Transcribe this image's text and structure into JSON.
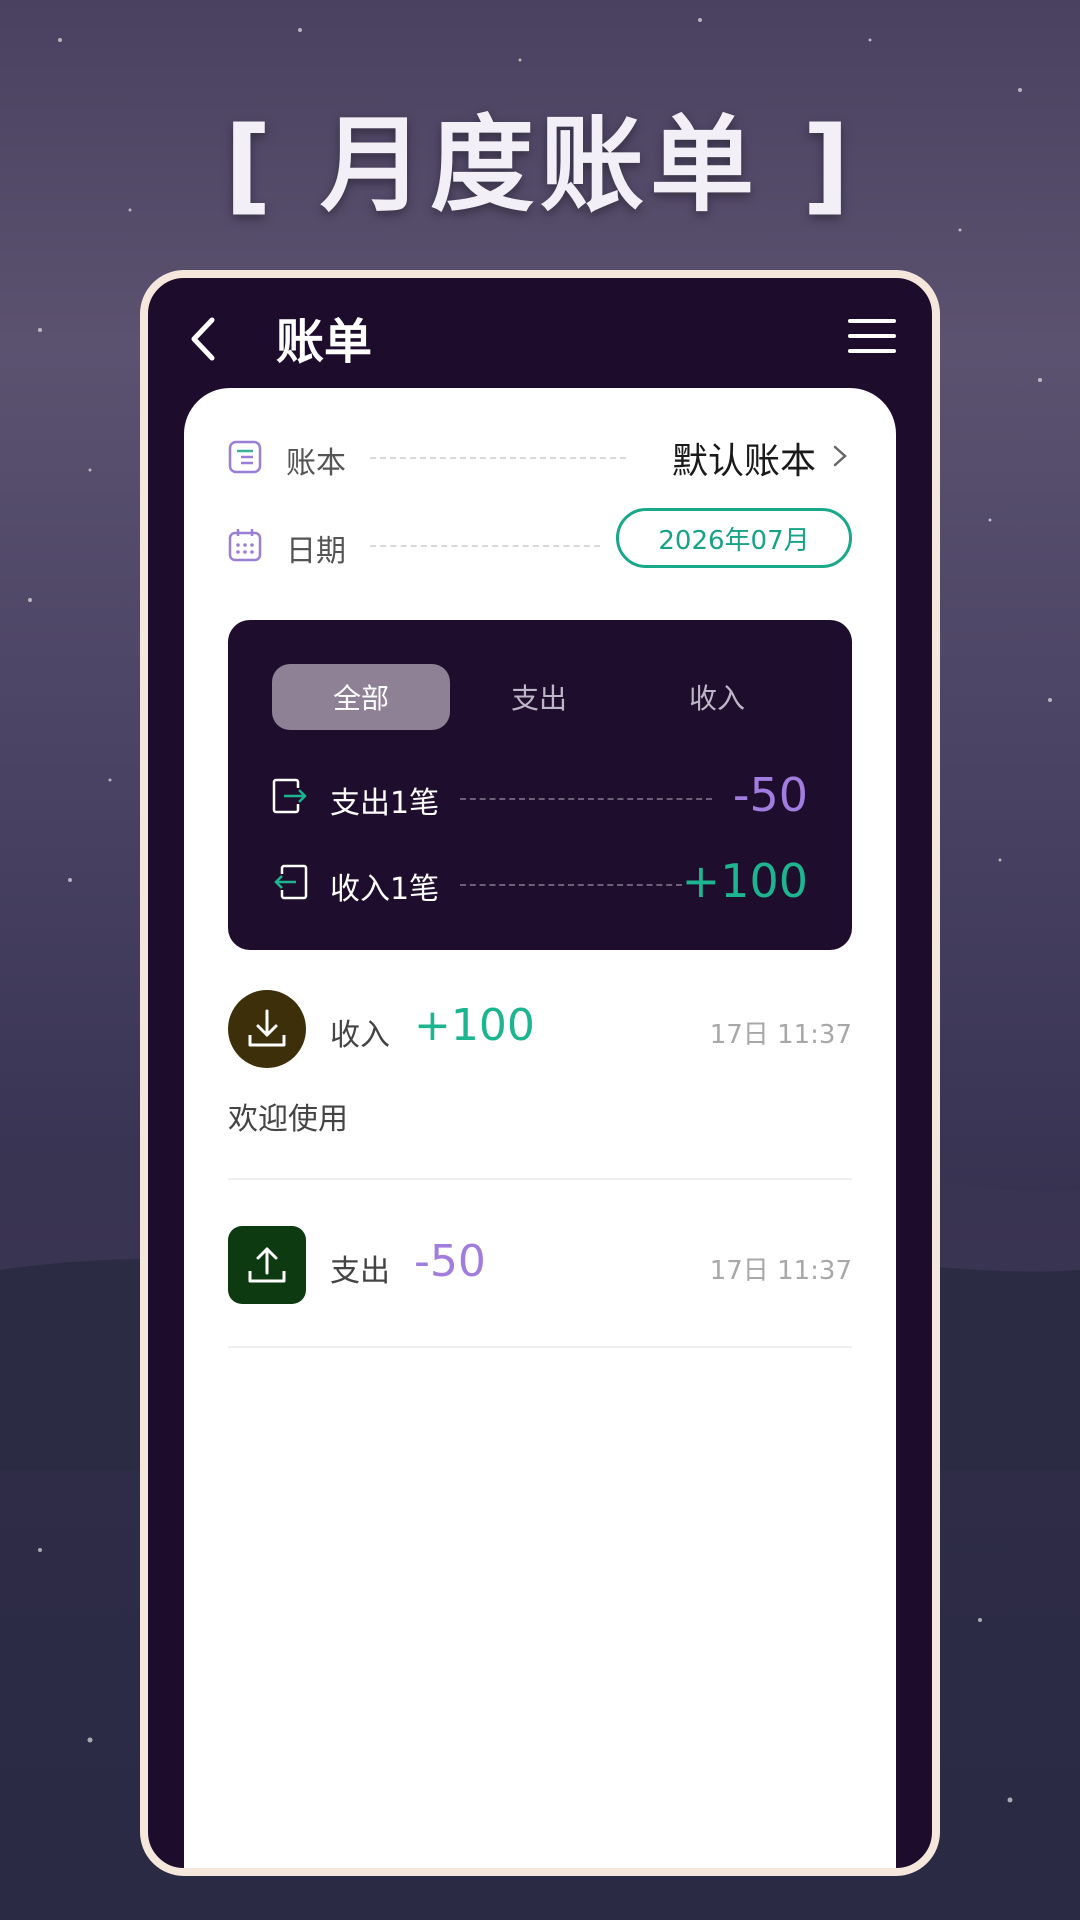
{
  "page_title": "[ 月度账单 ]",
  "topbar": {
    "title": "账单"
  },
  "book": {
    "label": "账本",
    "value": "默认账本"
  },
  "date": {
    "label": "日期",
    "value": "2026年07月"
  },
  "tabs": [
    {
      "label": "全部",
      "active": true
    },
    {
      "label": "支出",
      "active": false
    },
    {
      "label": "收入",
      "active": false
    }
  ],
  "summary": {
    "expense": {
      "label": "支出1笔",
      "amount": "-50"
    },
    "income": {
      "label": "收入1笔",
      "amount": "+100"
    }
  },
  "transactions": [
    {
      "type": "收入",
      "amount": "+100",
      "time": "17日 11:37",
      "note": "欢迎使用",
      "icon": "download-icon"
    },
    {
      "type": "支出",
      "amount": "-50",
      "time": "17日 11:37",
      "note": "",
      "icon": "upload-icon"
    }
  ],
  "colors": {
    "frame_bg": "#1d0c2c",
    "income": "#1cb58f",
    "expense": "#a27de0",
    "accent": "#1aa88a"
  }
}
